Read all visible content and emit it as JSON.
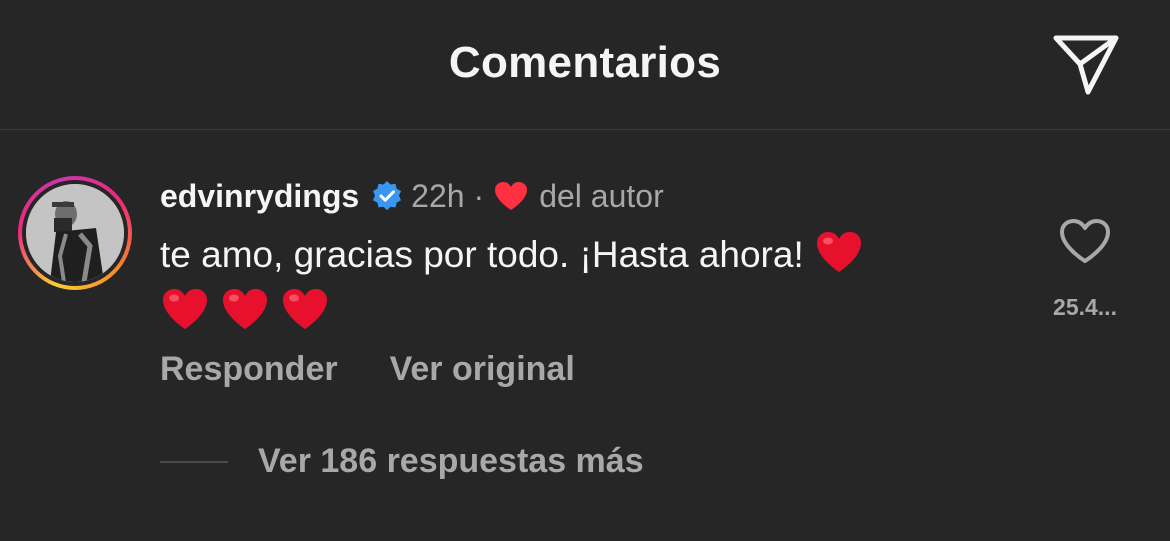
{
  "header": {
    "title": "Comentarios",
    "share_icon": "paper-plane-icon"
  },
  "comment": {
    "username": "edvinrydings",
    "verified_icon": "verified-badge-icon",
    "time": "22h",
    "separator": "·",
    "author_heart_icon": "heart-filled-icon",
    "author_label": "del autor",
    "text": "te amo, gracias por todo. ¡Hasta ahora! ",
    "emoji": "red-heart-emoji",
    "like_icon": "heart-outline-icon",
    "like_count": "25.4...",
    "actions": {
      "reply": "Responder",
      "view_original": "Ver original"
    },
    "replies_label": "Ver 186 respuestas más"
  },
  "colors": {
    "background": "#262626",
    "text_primary": "#f5f5f5",
    "text_secondary": "#a8a8a8",
    "verified_blue": "#3897f0",
    "heart_red": "#ff3040"
  }
}
